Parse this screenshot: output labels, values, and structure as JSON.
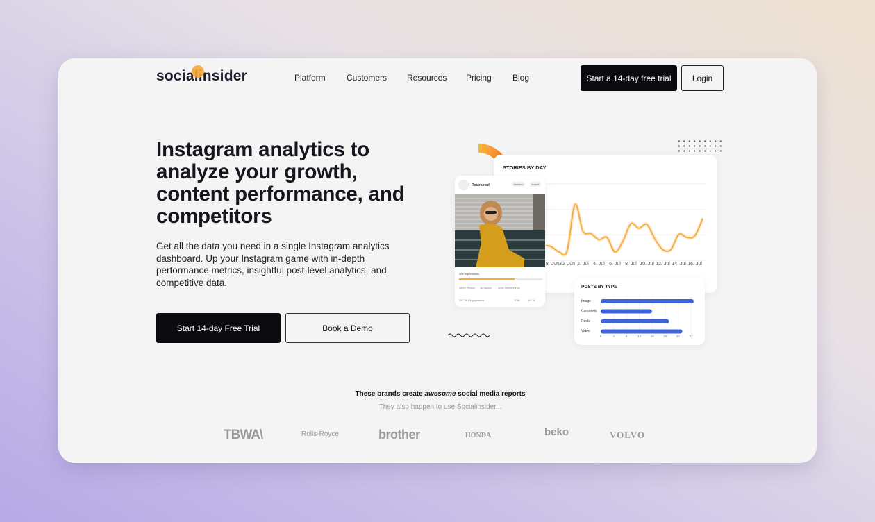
{
  "header": {
    "logo": "socialinsider",
    "nav": [
      "Platform",
      "Customers",
      "Resources",
      "Pricing",
      "Blog"
    ],
    "trial_button": "Start a 14-day free trial",
    "login_button": "Login"
  },
  "hero": {
    "title": "Instagram analytics to analyze your growth, content performance, and competitors",
    "subtitle": "Get all the data you need in a single Instagram analytics dashboard. Up your Instagram game with in-depth performance metrics, insightful post-level analytics, and competitive data.",
    "primary_cta": "Start 14-day Free Trial",
    "secondary_cta": "Book a Demo"
  },
  "post_card": {
    "account": "Restrained",
    "tags": [
      "fashion",
      "travel"
    ],
    "impressions": "40k Impressions",
    "impressions_progress": 0.67,
    "stats": [
      "389% Reach",
      "1k Saved",
      "400k Video Views"
    ],
    "engagement": "257.4k Engagement",
    "likes": "105k",
    "comments": "54.4k"
  },
  "chart_data": [
    {
      "type": "line",
      "title": "STORIES BY DAY",
      "x": [
        "27. Jun",
        "28. Jun",
        "29. Jun",
        "30. Jun",
        "1. Jul",
        "2. Jul",
        "3. Jul",
        "4. Jul",
        "5. Jul",
        "6. Jul",
        "7. Jul",
        "8. Jul",
        "9. Jul",
        "10. Jul",
        "11. Jul",
        "12. Jul",
        "13. Jul",
        "14. Jul",
        "15. Jul",
        "16. Jul",
        "17. Jul"
      ],
      "values": [
        20,
        18,
        11,
        12,
        73,
        38,
        35,
        27,
        30,
        11,
        25,
        48,
        42,
        47,
        28,
        14,
        14,
        34,
        30,
        32,
        55
      ],
      "tick_labels": [
        "28. Jun",
        "30. Jun",
        "2. Jul",
        "4. Jul",
        "6. Jul",
        "8. Jul",
        "10. Jul",
        "12. Jul",
        "14. Jul",
        "16. Jul"
      ],
      "color": "#f5a93a",
      "grid": true
    },
    {
      "type": "bar",
      "orientation": "horizontal",
      "title": "POSTS BY TYPE",
      "categories": [
        "Image",
        "Carousels",
        "Reels",
        "Video"
      ],
      "values": [
        24.5,
        13.5,
        18,
        21.5
      ],
      "tick_labels": [
        "0",
        "4",
        "8",
        "12",
        "16",
        "20",
        "22",
        "24"
      ],
      "color": "#3f63d8",
      "grid": true
    }
  ],
  "brands": {
    "title_pre": "These brands create ",
    "title_em": "awesome",
    "title_post": " social media reports",
    "subtitle": "They also happen to use Socialinsider...",
    "logos": [
      "TBWA\\",
      "Rolls-Royce",
      "brother",
      "HONDA",
      "beko",
      "VOLVO"
    ]
  }
}
